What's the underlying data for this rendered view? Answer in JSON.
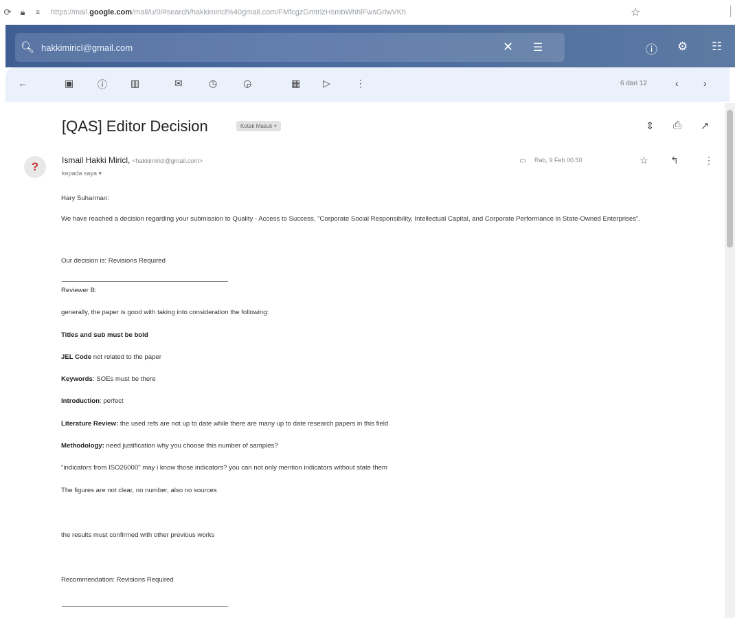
{
  "browser": {
    "url_domain": "google.com",
    "url_prefix": "https://mail.",
    "url_suffix": "/mail/u/0/#search/hakkimiricl%40gmail.com/FMfcgzGmtrlzHsmbWhhlFwsGrlwVKh"
  },
  "header": {
    "search_value": "hakkimiricl@gmail.com"
  },
  "toolbar": {
    "pager": "6 dari 12"
  },
  "message": {
    "subject": "[QAS] Editor Decision",
    "label": "Kotak Masuk ×",
    "sender_name": "Ismail Hakki Miricl,",
    "sender_email": "<hakkimiricl@gmail.com>",
    "recipient": "kepada saya ▾",
    "time": "Rab, 9 Feb 00.50",
    "avatar": "?"
  },
  "body": {
    "greeting": "Hary Suharman:",
    "intro": "We have reached a decision regarding your submission to Quality - Access to Success, \"Corporate Social Responsibility, Intellectual Capital, and Corporate Performance in State-Owned Enterprises\".",
    "decision": "Our decision is: Revisions Required",
    "reviewer": "Reviewer B:",
    "general": "generally, the paper is good with taking into consideration the following:",
    "titles": "Titles and sub must be bold",
    "jel_label": "JEL Code",
    "jel_text": " not related to the paper",
    "kw_label": "Keywords",
    "kw_text": ": SOEs must be there",
    "intro_label": "Introduction",
    "intro_text": ": perfect",
    "lit_label": "Literature Review:",
    "lit_text": " the used refs are not up to date while there are many up to date research papers in this field",
    "meth_label": "Methodology:",
    "meth_text": " need justification why you choose this number of samples?",
    "indicators": "\"indicators from ISO26000\" may i know those indicators? you can not only mention indicators without state them",
    "figures": "The figures are not clear, no number, also no sources",
    "results": "the results must confirmed with other previous works",
    "recommendation": "Recommendation: Revisions Required"
  }
}
